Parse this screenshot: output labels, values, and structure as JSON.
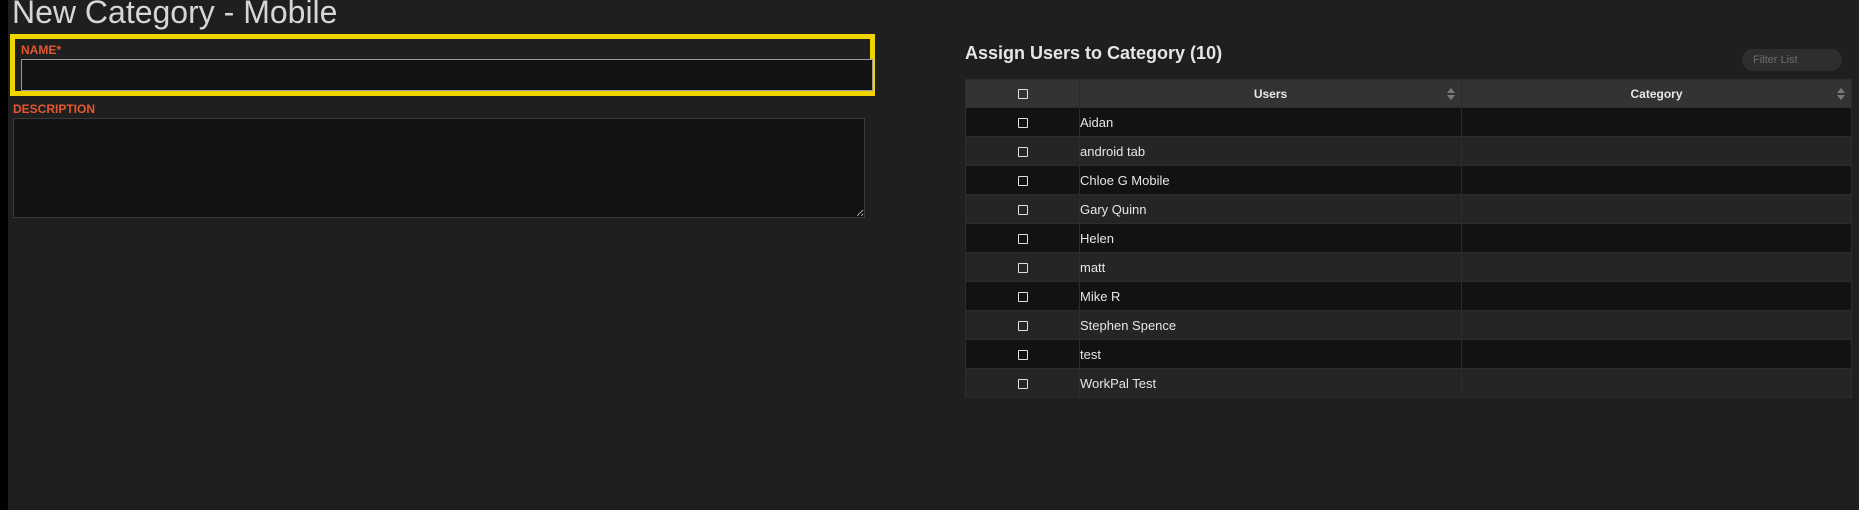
{
  "page": {
    "title": "New Category - Mobile"
  },
  "form": {
    "name_label": "NAME*",
    "name_value": "",
    "description_label": "DESCRIPTION",
    "description_value": ""
  },
  "assign": {
    "title": "Assign Users to Category (10)",
    "filter_placeholder": "Filter List",
    "columns": [
      "Users",
      "Category"
    ],
    "rows": [
      {
        "user": "Aidan",
        "category": ""
      },
      {
        "user": "android tab",
        "category": ""
      },
      {
        "user": "Chloe G Mobile",
        "category": ""
      },
      {
        "user": "Gary Quinn",
        "category": ""
      },
      {
        "user": "Helen",
        "category": ""
      },
      {
        "user": "matt",
        "category": ""
      },
      {
        "user": "Mike R",
        "category": ""
      },
      {
        "user": "Stephen Spence",
        "category": ""
      },
      {
        "user": "test",
        "category": ""
      },
      {
        "user": "WorkPal Test",
        "category": ""
      }
    ]
  },
  "colors": {
    "highlight": "#f0d400",
    "label": "#e4572e",
    "background": "#1f1f1f"
  }
}
